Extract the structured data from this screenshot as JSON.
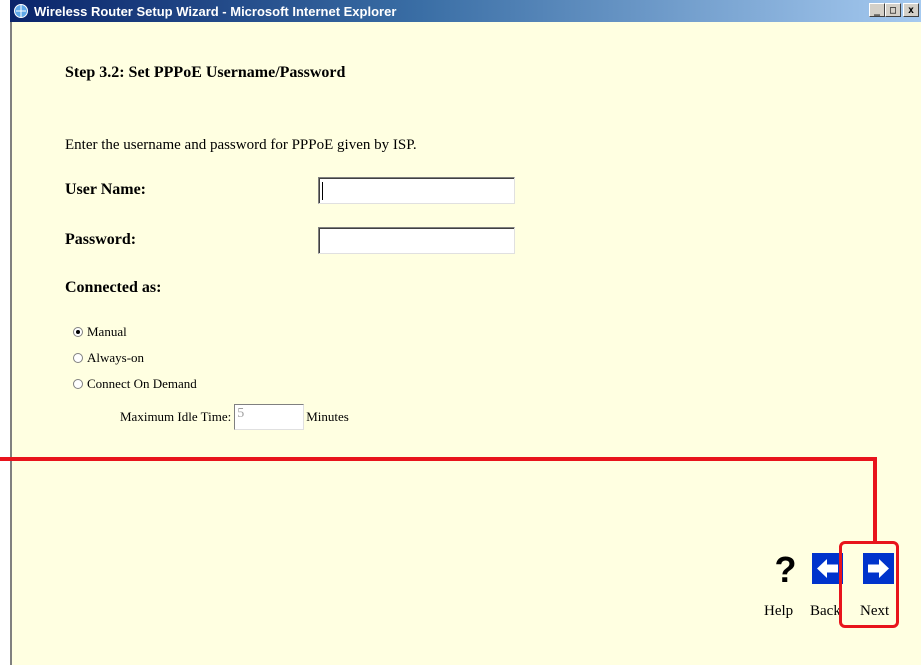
{
  "window": {
    "title": "Wireless Router Setup Wizard - Microsoft Internet Explorer",
    "buttons": {
      "minimize": "_",
      "maximize": "□",
      "close": "x"
    }
  },
  "step": {
    "heading": "Step 3.2: Set PPPoE Username/Password",
    "instruction": "Enter the username and password for PPPoE given by ISP."
  },
  "form": {
    "username_label": "User Name:",
    "username_value": "",
    "password_label": "Password:",
    "password_value": "",
    "connected_as_label": "Connected as:",
    "connection_modes": [
      {
        "label": "Manual",
        "selected": true
      },
      {
        "label": "Always-on",
        "selected": false
      },
      {
        "label": "Connect On Demand",
        "selected": false
      }
    ],
    "idle_time_label": "Maximum Idle Time:",
    "idle_time_value": "5",
    "idle_time_unit": "Minutes"
  },
  "nav": {
    "help_label": "Help",
    "back_label": "Back",
    "next_label": "Next"
  },
  "colors": {
    "page_bg": "#ffffe1",
    "annotation": "#e8141c",
    "nav_icon_bg": "#0033cc"
  }
}
